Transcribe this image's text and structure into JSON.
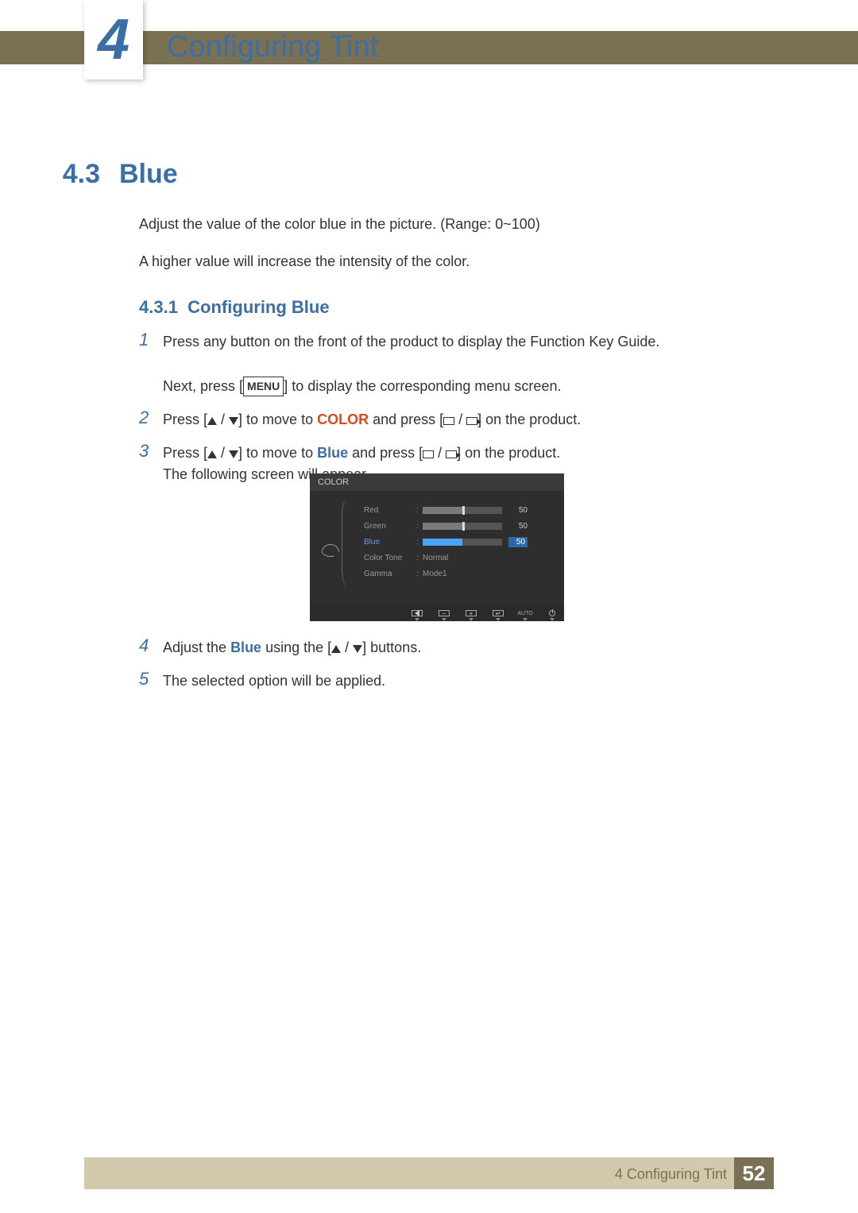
{
  "chapter": {
    "number": "4",
    "title": "Configuring Tint"
  },
  "section": {
    "number": "4.3",
    "title": "Blue"
  },
  "intro": {
    "line1": "Adjust the value of the color blue in the picture. (Range: 0~100)",
    "line2": "A higher value will increase the intensity of the color."
  },
  "subsection": {
    "number": "4.3.1",
    "title": "Configuring Blue"
  },
  "steps": {
    "s1": {
      "num": "1",
      "a": "Press any button on the front of the product to display the Function Key Guide.",
      "b1": "Next, press [",
      "menu": "MENU",
      "b2": "] to display the corresponding menu screen."
    },
    "s2": {
      "num": "2",
      "a": "Press [",
      "b": "] to move to ",
      "kw": "COLOR",
      "c": " and press [",
      "d": "] on the product."
    },
    "s3": {
      "num": "3",
      "a": "Press [",
      "b": "] to move to ",
      "kw": "Blue",
      "c": " and press [",
      "d": "] on the product.",
      "e": "The following screen will appear."
    },
    "s4": {
      "num": "4",
      "a": "Adjust the ",
      "kw": "Blue",
      "b": " using the [",
      "c": "] buttons."
    },
    "s5": {
      "num": "5",
      "a": "The selected option will be applied."
    }
  },
  "osd": {
    "header": "COLOR",
    "rows": {
      "red": {
        "label": "Red",
        "value": "50"
      },
      "green": {
        "label": "Green",
        "value": "50"
      },
      "blue": {
        "label": "Blue",
        "value": "50"
      },
      "tone": {
        "label": "Color Tone",
        "value": "Normal"
      },
      "gamma": {
        "label": "Gamma",
        "value": "Mode1"
      }
    },
    "footer": {
      "auto": "AUTO"
    }
  },
  "footer": {
    "label": "4 Configuring Tint",
    "page": "52"
  }
}
